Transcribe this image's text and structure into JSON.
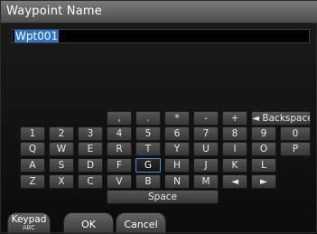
{
  "window": {
    "title": "Waypoint Name"
  },
  "name_field": {
    "value": "Wpt001"
  },
  "keyboard": {
    "punct": [
      ",",
      ".",
      "*",
      "-",
      "+"
    ],
    "backspace_label": "◄ Backspace",
    "digits": [
      "1",
      "2",
      "3",
      "4",
      "5",
      "6",
      "7",
      "8",
      "9",
      "0"
    ],
    "row_q": [
      "Q",
      "W",
      "E",
      "R",
      "T",
      "Y",
      "U",
      "I",
      "O",
      "P"
    ],
    "row_a": [
      "A",
      "S",
      "D",
      "F",
      "G",
      "H",
      "J",
      "K",
      "L"
    ],
    "row_z": [
      "Z",
      "X",
      "C",
      "V",
      "B",
      "N",
      "M"
    ],
    "left_arrow": "◄",
    "right_arrow": "►",
    "space_label": "Space",
    "selected_key": "G"
  },
  "softkeys": {
    "keypad_label": "Keypad",
    "keypad_sub": "ABC",
    "ok_label": "OK",
    "cancel_label": "Cancel"
  }
}
